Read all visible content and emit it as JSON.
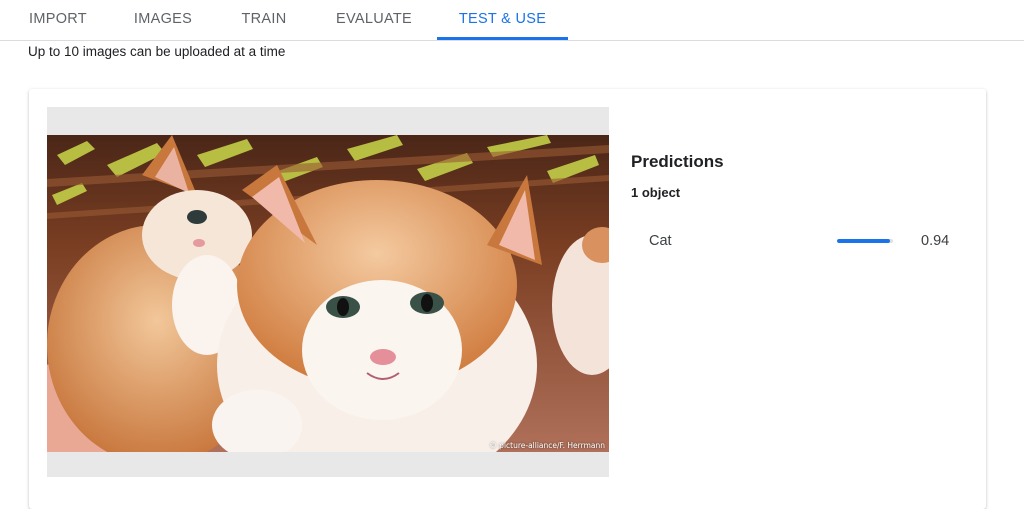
{
  "tabs": [
    {
      "label": "IMPORT",
      "active": false
    },
    {
      "label": "IMAGES",
      "active": false
    },
    {
      "label": "TRAIN",
      "active": false
    },
    {
      "label": "EVALUATE",
      "active": false
    },
    {
      "label": "TEST & USE",
      "active": true
    }
  ],
  "upload_hint": "Up to 10 images can be uploaded at a time",
  "image": {
    "subject": "two orange and white kittens in a wicker basket",
    "credit": "© picture-alliance/F. Herrmann"
  },
  "predictions": {
    "title": "Predictions",
    "count_label": "1 object",
    "items": [
      {
        "label": "Cat",
        "score": "0.94",
        "score_value": 0.94
      }
    ]
  },
  "colors": {
    "accent": "#1a73e8",
    "tab_inactive": "#5f6368",
    "frame_bg": "#e8e8e8"
  }
}
